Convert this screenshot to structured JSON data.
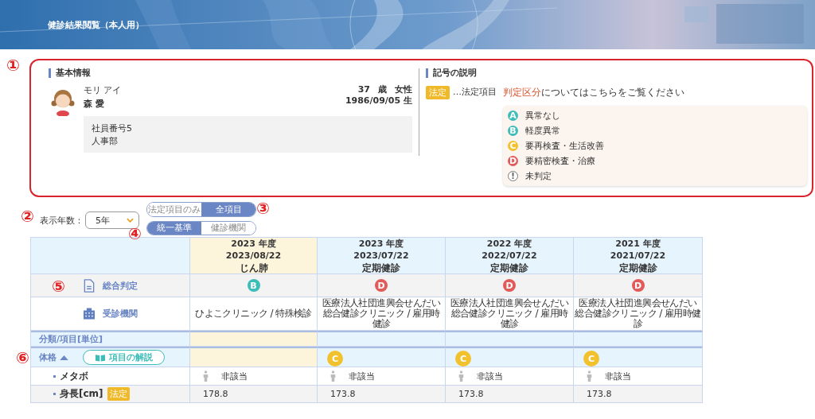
{
  "header": {
    "title": "健診結果閲覧（本人用）"
  },
  "annotations": [
    {
      "text": "①",
      "kind": "box"
    },
    {
      "text": "②",
      "kind": "years"
    },
    {
      "text": "③",
      "kind": "scope"
    },
    {
      "text": "④",
      "kind": "standard"
    },
    {
      "text": "⑤",
      "kind": "overall"
    },
    {
      "text": "⑥",
      "kind": "section"
    }
  ],
  "basic_info": {
    "title": "基本情報",
    "furigana": "モリ アイ",
    "name": "森 愛",
    "age": "37",
    "age_unit": "歳",
    "gender": "女性",
    "birthdate": "1986/09/05 生",
    "employee_no": "社員番号5",
    "department": "人事部"
  },
  "legend": {
    "title": "記号の説明",
    "badge": "法定",
    "badge_note": "…法定項目",
    "link": "判定区分",
    "link_rest": "についてはこちらをご覧ください",
    "grades": [
      {
        "kind": "grade",
        "letter": "A",
        "label": "異常なし",
        "color": "#3dbdb8"
      },
      {
        "kind": "grade",
        "letter": "B",
        "label": "軽度異常",
        "color": "#3dbdb8"
      },
      {
        "kind": "grade",
        "letter": "C",
        "label": "要再検査・生活改善",
        "color": "#f2c12e"
      },
      {
        "kind": "grade",
        "letter": "D",
        "label": "要精密検査・治療",
        "color": "#e15b5b"
      },
      {
        "kind": "pending",
        "letter": "!",
        "label": "未判定"
      }
    ]
  },
  "controls": {
    "years_label": "表示年数：",
    "years_value": "5年",
    "scope": [
      {
        "label": "法定項目のみ",
        "selected": false
      },
      {
        "label": "全項目",
        "selected": true
      }
    ],
    "standard": [
      {
        "label": "統一基準",
        "selected": true
      },
      {
        "label": "健診機関",
        "selected": false
      }
    ]
  },
  "table": {
    "overall_label": "総合判定",
    "clinic_label": "受診機関",
    "category_header": "分類/項目[単位]",
    "section": {
      "label": "体格",
      "expanded": true,
      "guide_button": "項目の解説"
    },
    "columns": [
      {
        "year": "2023 年度",
        "date": "2023/08/22",
        "type": "じん肺",
        "selected": true,
        "overall": {
          "letter": "B",
          "color": "#3dbdb8"
        },
        "clinic": "ひよこクリニック / 特殊検診"
      },
      {
        "year": "2023 年度",
        "date": "2023/07/22",
        "type": "定期健診",
        "selected": false,
        "overall": {
          "letter": "D",
          "color": "#e15b5b"
        },
        "clinic": "医療法人社団進興会せんだい総合健診クリニック / 雇用時健診",
        "section_grade": {
          "letter": "C",
          "color": "#f2c12e"
        }
      },
      {
        "year": "2022 年度",
        "date": "2022/07/22",
        "type": "定期健診",
        "selected": false,
        "overall": {
          "letter": "D",
          "color": "#e15b5b"
        },
        "clinic": "医療法人社団進興会せんだい総合健診クリニック / 雇用時健診",
        "section_grade": {
          "letter": "C",
          "color": "#f2c12e"
        }
      },
      {
        "year": "2021 年度",
        "date": "2021/07/22",
        "type": "定期健診",
        "selected": false,
        "overall": {
          "letter": "D",
          "color": "#e15b5b"
        },
        "clinic": "医療法人社団進興会せんだい総合健診クリニック / 雇用時健診",
        "section_grade": {
          "letter": "C",
          "color": "#f2c12e"
        }
      }
    ],
    "items": [
      {
        "kind": "metabo",
        "label": "メタボ",
        "values": [
          "非該当",
          "非該当",
          "非該当",
          "非該当"
        ]
      },
      {
        "kind": "number",
        "label": "身長[cm]",
        "badge": "法定",
        "values": [
          "178.8",
          "173.8",
          "173.8",
          "173.8"
        ]
      }
    ]
  }
}
